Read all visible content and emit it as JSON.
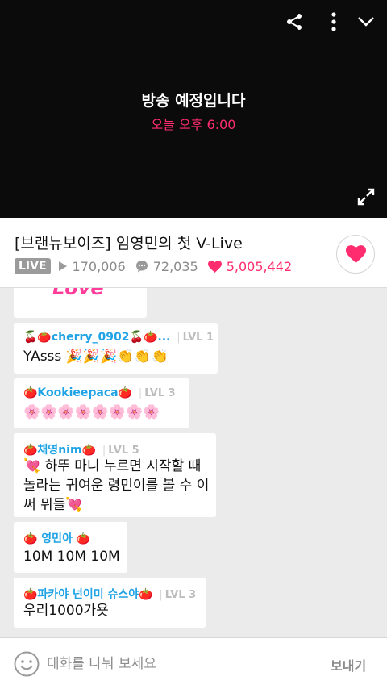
{
  "player": {
    "status_title": "방송 예정입니다",
    "scheduled_time": "오늘 오후 6:00"
  },
  "video": {
    "title": "[브랜뉴보이즈] 임영민의 첫 V-Live",
    "live_badge": "LIVE",
    "plays": "170,006",
    "comments": "72,035",
    "hearts": "5,005,442"
  },
  "chat": {
    "top_sticker_text": "Love",
    "messages": [
      {
        "name": "🍒🍅cherry_0902🍒🍅...",
        "level": "LVL 1",
        "text": "YAsss 🎉🎉🎉👏👏👏"
      },
      {
        "name": "🍅Kookieepaca🍅",
        "level": "LVL 3",
        "text": "🌸🌸🌸🌸🌸🌸🌸🌸"
      },
      {
        "name": "🍅채영nim🍅",
        "level": "LVL 5",
        "text": "💘 하뚜 마니 누르면 시작할 때\n놀라는 귀여운 령민이를 볼 수 이\n써 뮈들💘"
      },
      {
        "name": "🍅 영민아 🍅",
        "level": "",
        "text": "10M 10M 10M"
      },
      {
        "name": "🍅파카야 넌이미 슈스야🍅",
        "level": "LVL 3",
        "text": "우리1000가욧"
      }
    ]
  },
  "input": {
    "placeholder": "대화를 나눠 보세요",
    "send_label": "보내기"
  },
  "colors": {
    "accent": "#ff2d6f",
    "username": "#1fa3e5",
    "badge": "#9b9b9b"
  }
}
